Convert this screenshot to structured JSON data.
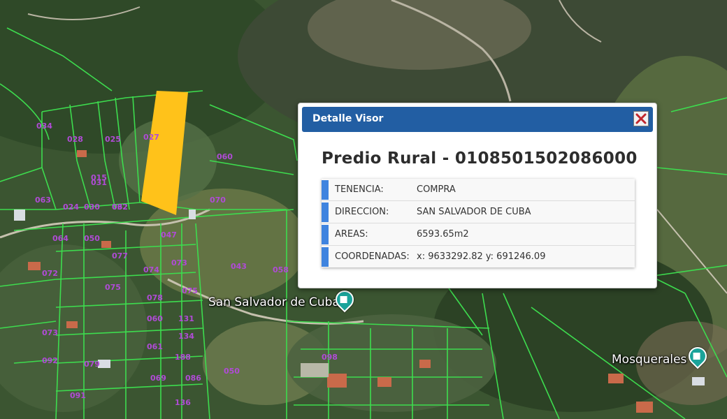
{
  "map": {
    "places": [
      {
        "name": "San Salvador de Cuba",
        "marker_icon": "castle-pin-icon"
      },
      {
        "name": "Mosquerales",
        "marker_icon": "castle-pin-icon"
      }
    ],
    "colors": {
      "parcel_lines": "#3ddc4e",
      "parcel_labels": "#b04bd6",
      "highlighted_parcel": "#ffc21a"
    },
    "parcel_numbers": [
      "034",
      "028",
      "025",
      "024",
      "031",
      "030",
      "063",
      "062",
      "027",
      "060",
      "070",
      "015",
      "032",
      "064",
      "050",
      "077",
      "072",
      "075",
      "078",
      "073",
      "074",
      "075",
      "131",
      "134",
      "188",
      "060",
      "061",
      "069",
      "136",
      "086",
      "047",
      "043",
      "058",
      "073",
      "079",
      "092",
      "050",
      "091",
      "098"
    ]
  },
  "popup": {
    "header_title": "Detalle Visor",
    "close_icon": "close-x-icon",
    "title": "Predio Rural - 0108501502086000",
    "rows": [
      {
        "label": "TENENCIA:",
        "value": "COMPRA"
      },
      {
        "label": "DIRECCION:",
        "value": "SAN SALVADOR DE CUBA"
      },
      {
        "label": "AREAS:",
        "value": "6593.65m2"
      },
      {
        "label": "COORDENADAS:",
        "value": "x: 9633292.82 y: 691246.09"
      }
    ],
    "colors": {
      "header": "#225ea3",
      "accent_bar": "#3f84df",
      "close_x": "#c0262d"
    }
  }
}
